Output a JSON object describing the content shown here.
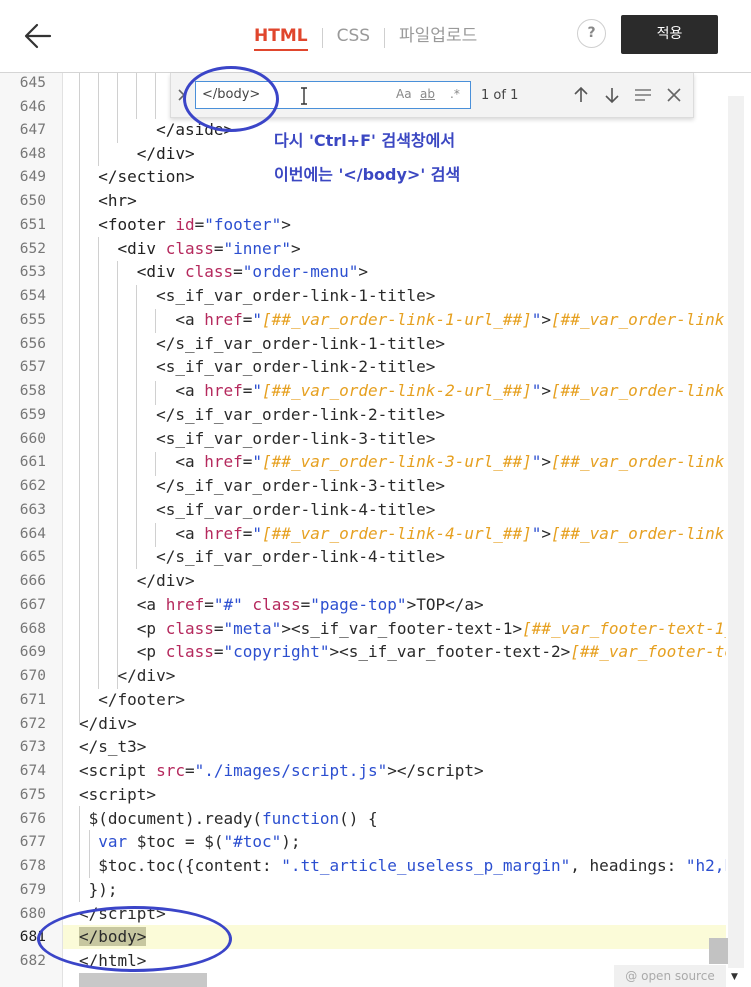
{
  "header": {
    "tabs": [
      {
        "label": "HTML",
        "active": true
      },
      {
        "label": "CSS",
        "active": false
      },
      {
        "label": "파일업로드",
        "active": false
      }
    ],
    "help_label": "?",
    "apply_label": "적용"
  },
  "search": {
    "query": "</body>",
    "opt_case": "Aa",
    "opt_word": "ab",
    "opt_regex": ".*",
    "count": "1 of 1"
  },
  "annotation": {
    "line1": "다시 'Ctrl+F' 검색창에서",
    "line2": "이번에는 '</body>' 검색"
  },
  "editor": {
    "line_numbers": [
      "645",
      "646",
      "647",
      "648",
      "649",
      "650",
      "651",
      "652",
      "653",
      "654",
      "655",
      "656",
      "657",
      "658",
      "659",
      "660",
      "661",
      "662",
      "663",
      "664",
      "665",
      "666",
      "667",
      "668",
      "669",
      "670",
      "671",
      "672",
      "673",
      "674",
      "675",
      "676",
      "677",
      "678",
      "679",
      "680",
      "681",
      "682"
    ],
    "active_line": "681"
  },
  "badge": "@ open source",
  "colors": {
    "accent": "#e0462d",
    "annotation": "#3b45c8",
    "apply_bg": "#2b2b2b",
    "line_highlight": "#fbfbd8"
  }
}
